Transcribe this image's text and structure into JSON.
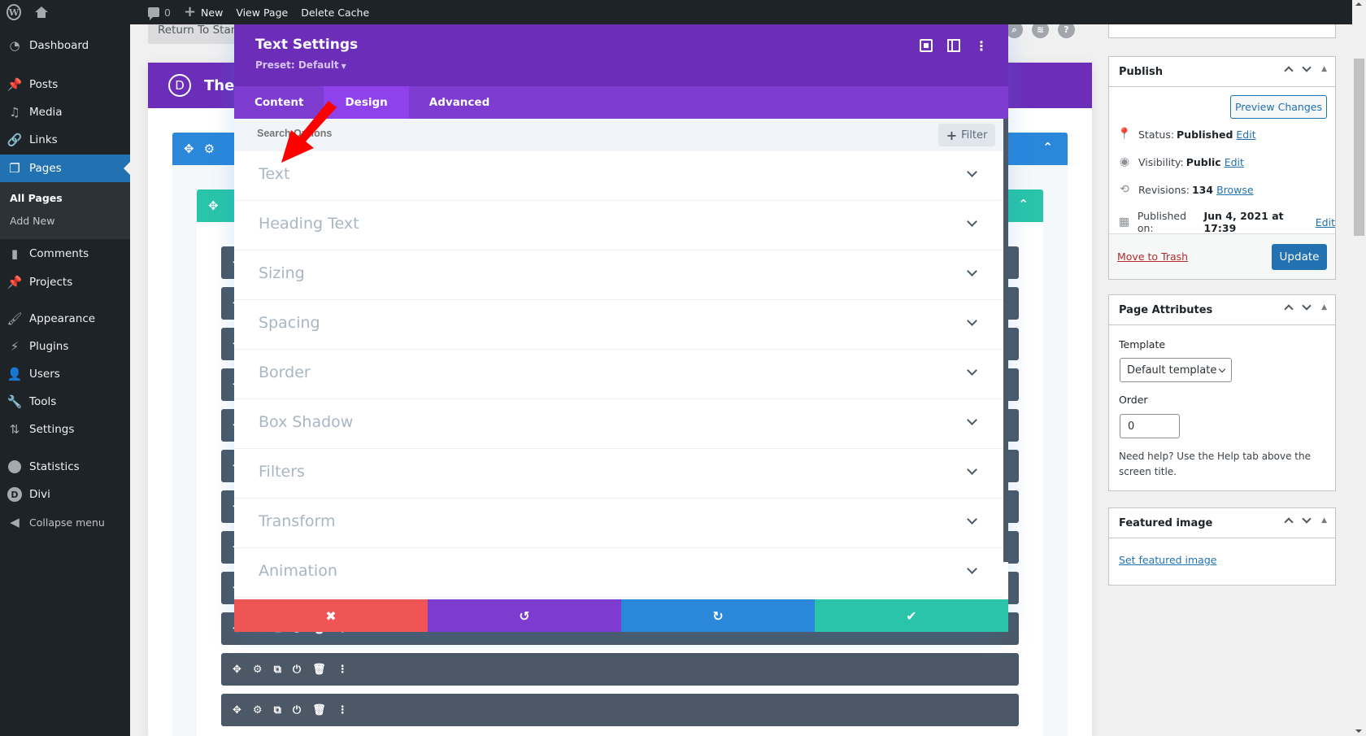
{
  "adminbar": {
    "logo_icon": "wordpress-logo-icon",
    "home_icon": "home-icon",
    "comments_count": "0",
    "new_label": "New",
    "view_page_label": "View Page",
    "delete_cache_label": "Delete Cache"
  },
  "sidebar": {
    "items": [
      {
        "label": "Dashboard",
        "icon": "dashboard-icon"
      },
      {
        "label": "Posts",
        "icon": "pin-icon"
      },
      {
        "label": "Media",
        "icon": "media-icon"
      },
      {
        "label": "Links",
        "icon": "link-icon"
      },
      {
        "label": "Pages",
        "icon": "pages-icon",
        "active": true
      },
      {
        "label": "Comments",
        "icon": "comment-icon"
      },
      {
        "label": "Projects",
        "icon": "pin-icon"
      },
      {
        "label": "Appearance",
        "icon": "brush-icon"
      },
      {
        "label": "Plugins",
        "icon": "plug-icon"
      },
      {
        "label": "Users",
        "icon": "user-icon"
      },
      {
        "label": "Tools",
        "icon": "wrench-icon"
      },
      {
        "label": "Settings",
        "icon": "sliders-icon"
      },
      {
        "label": "Statistics",
        "icon": "pie-icon"
      },
      {
        "label": "Divi",
        "icon": "divi-icon"
      },
      {
        "label": "Collapse menu",
        "icon": "collapse-icon"
      }
    ],
    "submenu": [
      {
        "label": "All Pages",
        "current": true
      },
      {
        "label": "Add New"
      }
    ]
  },
  "builder": {
    "return_label": "Return To Standard Editor",
    "page_title": "The",
    "logo_letter": "D",
    "floating_icons": [
      "search-icon",
      "layers-icon",
      "help-icon"
    ],
    "module_count": 12
  },
  "modal": {
    "title": "Text Settings",
    "preset": "Preset: Default",
    "tabs": [
      {
        "label": "Content"
      },
      {
        "label": "Design",
        "active": true
      },
      {
        "label": "Advanced"
      }
    ],
    "search_placeholder": "Search Options",
    "filter_label": "Filter",
    "options": [
      "Text",
      "Heading Text",
      "Sizing",
      "Spacing",
      "Border",
      "Box Shadow",
      "Filters",
      "Transform",
      "Animation"
    ],
    "footer": {
      "cancel_icon": "✖",
      "undo_icon": "↺",
      "redo_icon": "↻",
      "save_icon": "✔"
    },
    "colors": {
      "header": "#6c2eb9",
      "tabs": "#7e3bd0",
      "tab_active": "#8f42ec",
      "cancel": "#ef5555",
      "undo": "#7e3bd0",
      "redo": "#2b87da",
      "save": "#29c4a9"
    }
  },
  "publish": {
    "title": "Publish",
    "preview_label": "Preview Changes",
    "status_label": "Status:",
    "status_value": "Published",
    "visibility_label": "Visibility:",
    "visibility_value": "Public",
    "revisions_label": "Revisions:",
    "revisions_value": "134",
    "browse_label": "Browse",
    "published_label": "Published on:",
    "published_value": "Jun 4, 2021 at 17:39",
    "edit_label": "Edit",
    "trash_label": "Move to Trash",
    "update_label": "Update"
  },
  "page_attributes": {
    "title": "Page Attributes",
    "template_label": "Template",
    "template_value": "Default template",
    "order_label": "Order",
    "order_value": "0",
    "help_text": "Need help? Use the Help tab above the screen title."
  },
  "featured_image": {
    "title": "Featured image",
    "link_label": "Set featured image"
  }
}
